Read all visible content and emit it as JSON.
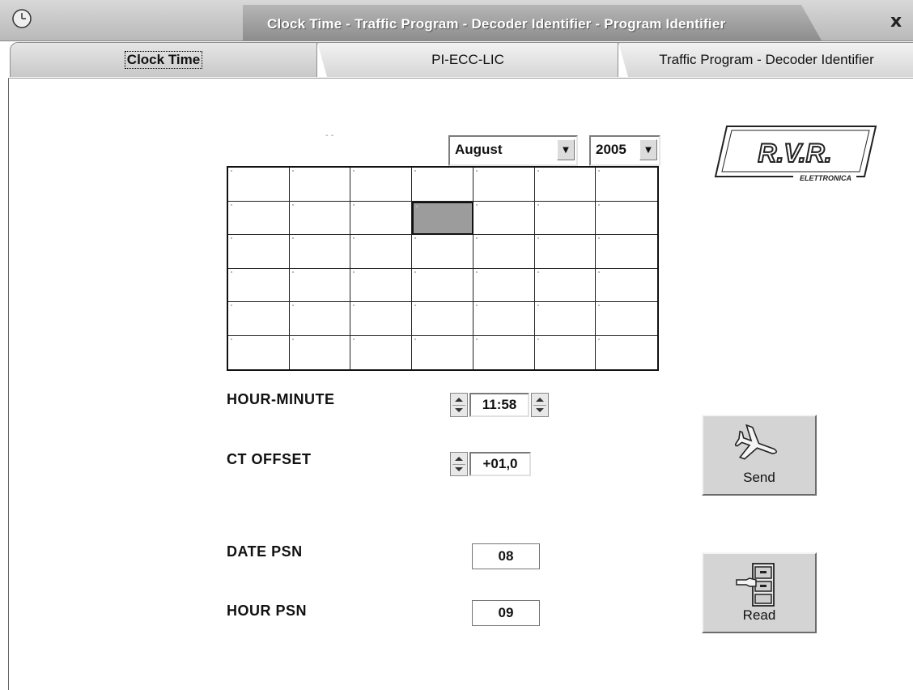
{
  "window": {
    "title": "Clock Time - Traffic Program - Decoder Identifier - Program Identifier",
    "close_symbol": "x",
    "icon": "clock-icon"
  },
  "tabs": [
    {
      "label": "Clock Time",
      "active": true
    },
    {
      "label": "PI-ECC-LIC",
      "active": false
    },
    {
      "label": "Traffic Program - Decoder Identifier",
      "active": false
    }
  ],
  "calendar": {
    "dash_text": "- -",
    "month": "August",
    "year": "2005",
    "rows": 6,
    "cols": 7,
    "selected_cell": {
      "row": 1,
      "col": 3
    }
  },
  "fields": {
    "hour_minute": {
      "label": "HOUR-MINUTE",
      "value": "11:58"
    },
    "ct_offset": {
      "label": "CT OFFSET",
      "value": "+01,0"
    },
    "date_psn": {
      "label": "DATE PSN",
      "value": "08"
    },
    "hour_psn": {
      "label": "HOUR PSN",
      "value": "09"
    }
  },
  "buttons": {
    "send": {
      "label": "Send",
      "icon": "airplane-icon"
    },
    "read": {
      "label": "Read",
      "icon": "file-cabinet-icon"
    }
  },
  "logo": {
    "main_text": "R.V.R.",
    "sub_text": "ELETTRONICA"
  },
  "colors": {
    "selected_cell": "#9c9c9c",
    "titlebar": "#b9b9b9",
    "tab_title_text": "#ffffff"
  }
}
